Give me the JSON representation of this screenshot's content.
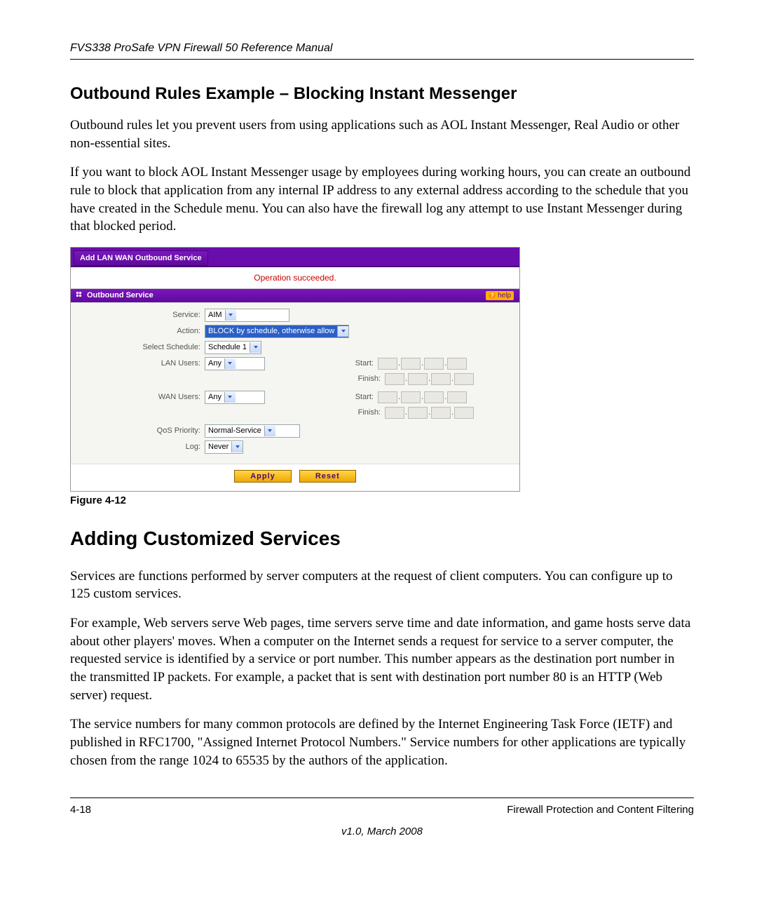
{
  "header": {
    "title": "FVS338 ProSafe VPN Firewall 50 Reference Manual"
  },
  "section1": {
    "heading": "Outbound Rules Example – Blocking Instant Messenger",
    "p1": "Outbound rules let you prevent users from using applications such as AOL Instant Messenger, Real Audio or other non-essential sites.",
    "p2": "If you want to block AOL Instant Messenger usage by employees during working hours, you can create an outbound rule to block that application from any internal IP address to any external address according to the schedule that you have created in the Schedule menu. You can also have the firewall log any attempt to use Instant Messenger during that blocked period."
  },
  "ui": {
    "window_title": "Add LAN WAN Outbound Service",
    "status": "Operation succeeded.",
    "section_label": "Outbound Service",
    "help_label": "help",
    "fields": {
      "service": {
        "label": "Service:",
        "value": "AIM"
      },
      "action": {
        "label": "Action:",
        "value": "BLOCK by schedule, otherwise allow"
      },
      "schedule": {
        "label": "Select Schedule:",
        "value": "Schedule 1"
      },
      "lan_users": {
        "label": "LAN Users:",
        "value": "Any"
      },
      "wan_users": {
        "label": "WAN Users:",
        "value": "Any"
      },
      "qos": {
        "label": "QoS Priority:",
        "value": "Normal-Service"
      },
      "log": {
        "label": "Log:",
        "value": "Never"
      },
      "start": "Start:",
      "finish": "Finish:"
    },
    "buttons": {
      "apply": "Apply",
      "reset": "Reset"
    }
  },
  "figure_caption": "Figure 4-12",
  "section2": {
    "heading": "Adding Customized Services",
    "p1": "Services are functions performed by server computers at the request of client computers. You can configure up to 125 custom services.",
    "p2": "For example, Web servers serve Web pages, time servers serve time and date information, and game hosts serve data about other players' moves. When a computer on the Internet sends a request for service to a server computer, the requested service is identified by a service or port number. This number appears as the destination port number in the transmitted IP packets. For example, a packet that is sent with destination port number 80 is an HTTP (Web server) request.",
    "p3": "The service numbers for many common protocols are defined by the Internet Engineering Task Force (IETF) and published in RFC1700, \"Assigned Internet Protocol Numbers.\" Service numbers for other applications are typically chosen from the range 1024 to 65535 by the authors of the application."
  },
  "footer": {
    "page": "4-18",
    "chapter": "Firewall Protection and Content Filtering",
    "version": "v1.0, March 2008"
  }
}
